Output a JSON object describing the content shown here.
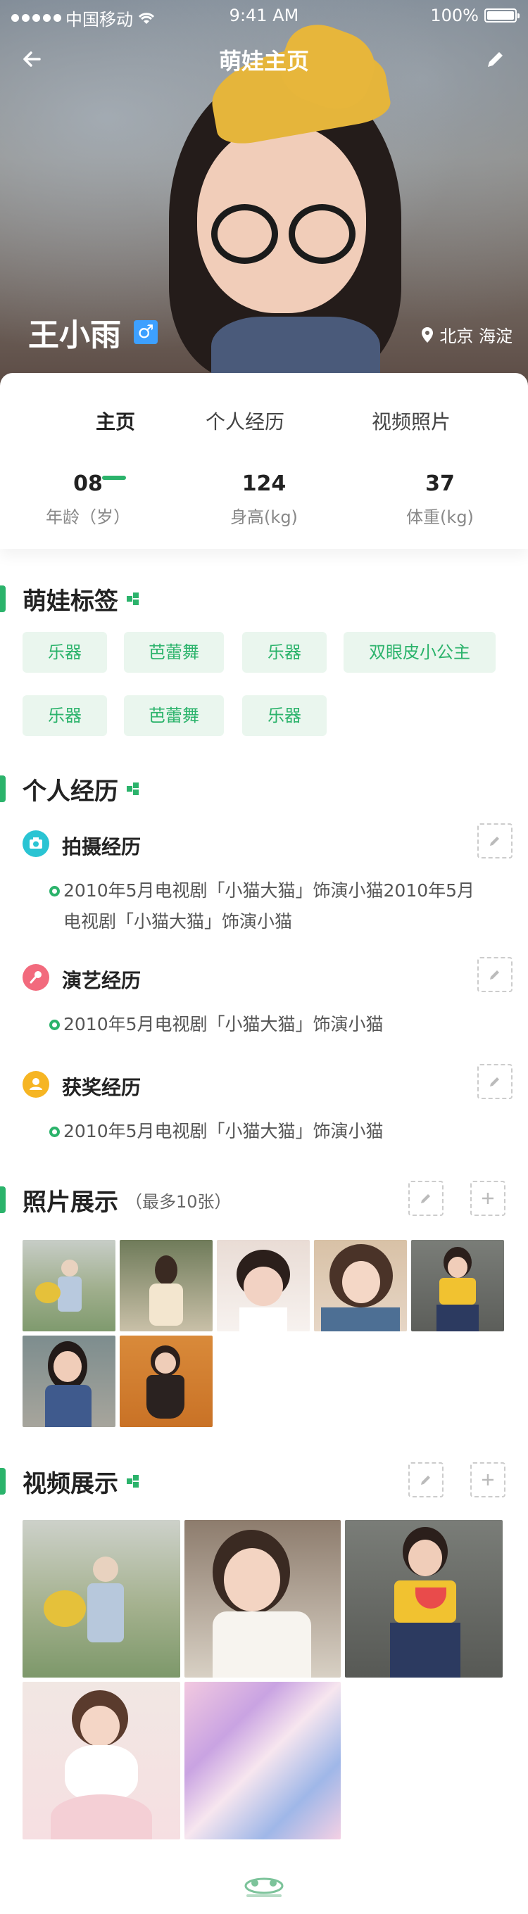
{
  "status_bar": {
    "carrier": "中国移动",
    "time": "9:41 AM",
    "battery": "100%",
    "battery_level": 1.0
  },
  "nav": {
    "title": "萌娃主页",
    "back_icon": "arrow-left-icon",
    "edit_icon": "pencil-icon"
  },
  "profile": {
    "name": "王小雨",
    "gender_symbol": "♂",
    "location": "北京  海淀"
  },
  "tabs": [
    {
      "label": "主页",
      "active": true
    },
    {
      "label": "个人经历",
      "active": false
    },
    {
      "label": "视频照片",
      "active": false
    }
  ],
  "stats": [
    {
      "value": "08",
      "label": "年龄（岁）"
    },
    {
      "value": "124",
      "label": "身高(kg)"
    },
    {
      "value": "37",
      "label": "体重(kg)"
    }
  ],
  "tags_section": {
    "title": "萌娃标签",
    "tags": [
      "乐器",
      "芭蕾舞",
      "乐器",
      "双眼皮小公主",
      "乐器",
      "芭蕾舞",
      "乐器"
    ]
  },
  "experience_section": {
    "title": "个人经历",
    "items": [
      {
        "title": "拍摄经历",
        "icon": "camera-icon",
        "color": "#2ac4d3",
        "desc": "2010年5月电视剧「小猫大猫」饰演小猫2010年5月电视剧「小猫大猫」饰演小猫"
      },
      {
        "title": "演艺经历",
        "icon": "microphone-icon",
        "color": "#f26a7d",
        "desc": "2010年5月电视剧「小猫大猫」饰演小猫"
      },
      {
        "title": "获奖经历",
        "icon": "user-award-icon",
        "color": "#f6b523",
        "desc": "2010年5月电视剧「小猫大猫」饰演小猫"
      }
    ]
  },
  "photos_section": {
    "title": "照片展示",
    "subtitle": "（最多10张）"
  },
  "videos_section": {
    "title": "视频展示"
  },
  "colors": {
    "accent": "#2bb36b",
    "chip_bg": "#eaf6ee"
  }
}
